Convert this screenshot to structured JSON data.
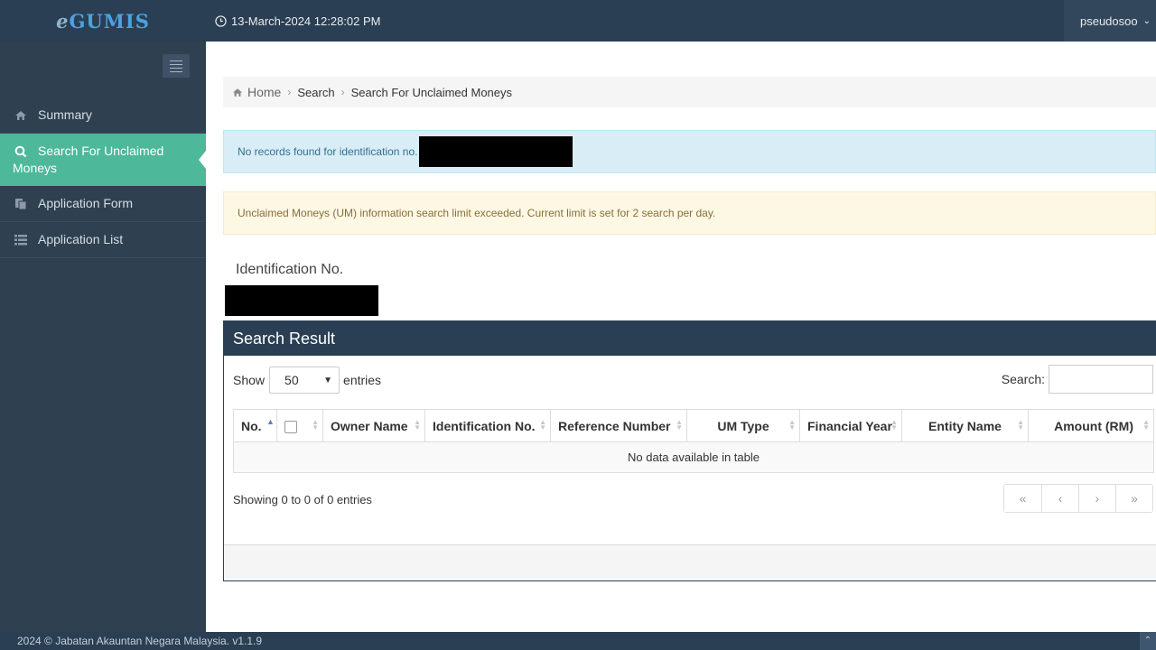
{
  "app": {
    "brand_prefix": "e",
    "brand_main": "GUMIS",
    "datetime": "13-March-2024 12:28:02 PM",
    "username": "pseudosoo"
  },
  "sidebar": {
    "items": [
      {
        "label": "Summary",
        "icon": "home-icon"
      },
      {
        "label": "Search For Unclaimed",
        "label2": "Moneys",
        "icon": "search-icon",
        "active": true
      },
      {
        "label": "Application Form",
        "icon": "copy-icon"
      },
      {
        "label": "Application List",
        "icon": "list-icon"
      }
    ]
  },
  "breadcrumb": {
    "home": "Home",
    "level1": "Search",
    "level2": "Search For Unclaimed Moneys"
  },
  "alerts": {
    "info": "No records found for identification no.",
    "warning": "Unclaimed Moneys (UM) information search limit exceeded. Current limit is set for 2 search per day."
  },
  "form": {
    "id_label": "Identification No."
  },
  "results": {
    "title": "Search Result",
    "show_label": "Show",
    "entries_value": "50",
    "entries_label": "entries",
    "search_label": "Search:",
    "columns": [
      "No.",
      "",
      "Owner Name",
      "Identification No.",
      "Reference Number",
      "UM Type",
      "Financial Year",
      "Entity Name",
      "Amount (RM)"
    ],
    "empty_message": "No data available in table",
    "info": "Showing 0 to 0 of 0 entries",
    "pager": [
      "«",
      "‹",
      "›",
      "»"
    ]
  },
  "footer": {
    "text": "2024 © Jabatan Akauntan Negara Malaysia. v1.1.9"
  },
  "colors": {
    "topbar": "#2a3f54",
    "sidebar": "#2f4050",
    "active": "#4db89a",
    "info_bg": "#d9edf7",
    "warning_bg": "#fcf8e3"
  }
}
